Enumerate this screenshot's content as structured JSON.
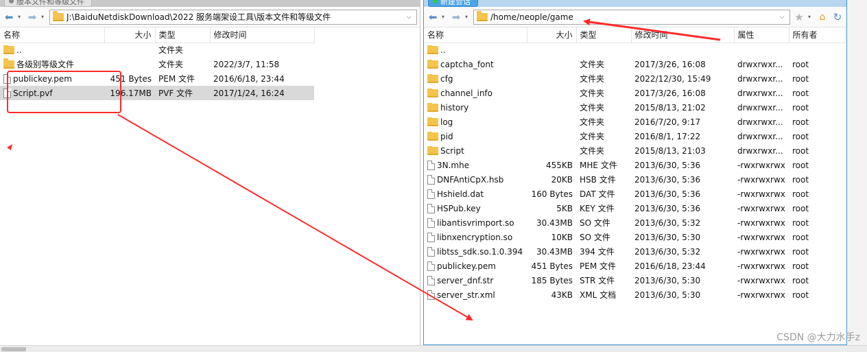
{
  "colors": {
    "annotation_red": "#ff2a2a",
    "accent_blue": "#3f95d6"
  },
  "left": {
    "tab_label": "版本文件和等级文件",
    "path": "J:\\BaiduNetdiskDownload\\2022 服务端架设工具\\版本文件和等级文件",
    "columns": {
      "name": "名称",
      "size": "大小",
      "type": "类型",
      "modified": "修改时间"
    },
    "rows": [
      {
        "icon": "folder-icon",
        "name": "..",
        "size": "",
        "type": "文件夹",
        "modified": ""
      },
      {
        "icon": "folder-icon",
        "name": "各级别等级文件",
        "size": "",
        "type": "文件夹",
        "modified": "2022/3/7, 11:58"
      },
      {
        "icon": "file-icon",
        "name": "publickey.pem",
        "size": "451 Bytes",
        "type": "PEM 文件",
        "modified": "2016/6/18, 23:44"
      },
      {
        "icon": "file-icon",
        "name": "Script.pvf",
        "size": "196.17MB",
        "type": "PVF 文件",
        "modified": "2017/1/24, 16:24"
      }
    ]
  },
  "right": {
    "tab_label": "新建会话",
    "path": "/home/neople/game",
    "columns": {
      "name": "名称",
      "size": "大小",
      "type": "类型",
      "modified": "修改时间",
      "attr": "属性",
      "owner": "所有者"
    },
    "rows": [
      {
        "icon": "folder-icon",
        "name": "..",
        "size": "",
        "type": "",
        "modified": "",
        "attr": "",
        "owner": ""
      },
      {
        "icon": "folder-icon",
        "name": "captcha_font",
        "size": "",
        "type": "文件夹",
        "modified": "2017/3/26, 16:08",
        "attr": "drwxrwxr...",
        "owner": "root"
      },
      {
        "icon": "folder-icon",
        "name": "cfg",
        "size": "",
        "type": "文件夹",
        "modified": "2022/12/30, 15:49",
        "attr": "drwxrwxr...",
        "owner": "root"
      },
      {
        "icon": "folder-icon",
        "name": "channel_info",
        "size": "",
        "type": "文件夹",
        "modified": "2017/3/26, 16:08",
        "attr": "drwxrwxr...",
        "owner": "root"
      },
      {
        "icon": "folder-icon",
        "name": "history",
        "size": "",
        "type": "文件夹",
        "modified": "2015/8/13, 21:02",
        "attr": "drwxrwxr...",
        "owner": "root"
      },
      {
        "icon": "folder-icon",
        "name": "log",
        "size": "",
        "type": "文件夹",
        "modified": "2016/7/20, 9:17",
        "attr": "drwxrwxr...",
        "owner": "root"
      },
      {
        "icon": "folder-icon",
        "name": "pid",
        "size": "",
        "type": "文件夹",
        "modified": "2016/8/1, 17:22",
        "attr": "drwxrwxr...",
        "owner": "root"
      },
      {
        "icon": "folder-icon",
        "name": "Script",
        "size": "",
        "type": "文件夹",
        "modified": "2015/8/13, 21:03",
        "attr": "drwxrwxr...",
        "owner": "root"
      },
      {
        "icon": "file-icon",
        "name": "3N.mhe",
        "size": "455KB",
        "type": "MHE 文件",
        "modified": "2013/6/30, 5:36",
        "attr": "-rwxrwxrwx",
        "owner": "root"
      },
      {
        "icon": "file-icon",
        "name": "DNFAntiCpX.hsb",
        "size": "20KB",
        "type": "HSB 文件",
        "modified": "2013/6/30, 5:36",
        "attr": "-rwxrwxrwx",
        "owner": "root"
      },
      {
        "icon": "file-icon",
        "name": "Hshield.dat",
        "size": "160 Bytes",
        "type": "DAT 文件",
        "modified": "2013/6/30, 5:36",
        "attr": "-rwxrwxrwx",
        "owner": "root"
      },
      {
        "icon": "file-icon",
        "name": "HSPub.key",
        "size": "5KB",
        "type": "KEY 文件",
        "modified": "2013/6/30, 5:36",
        "attr": "-rwxrwxrwx",
        "owner": "root"
      },
      {
        "icon": "file-icon",
        "name": "libantisvrimport.so",
        "size": "30.43MB",
        "type": "SO 文件",
        "modified": "2013/6/30, 5:32",
        "attr": "-rwxrwxrwx",
        "owner": "root"
      },
      {
        "icon": "file-icon",
        "name": "libnxencryption.so",
        "size": "10KB",
        "type": "SO 文件",
        "modified": "2013/6/30, 5:30",
        "attr": "-rwxrwxrwx",
        "owner": "root"
      },
      {
        "icon": "file-icon",
        "name": "libtss_sdk.so.1.0.394",
        "size": "30.43MB",
        "type": "394 文件",
        "modified": "2013/6/30, 5:32",
        "attr": "-rwxrwxrwx",
        "owner": "root"
      },
      {
        "icon": "file-icon",
        "name": "publickey.pem",
        "size": "451 Bytes",
        "type": "PEM 文件",
        "modified": "2016/6/18, 23:44",
        "attr": "-rwxrwxrwx",
        "owner": "root"
      },
      {
        "icon": "file-icon",
        "name": "server_dnf.str",
        "size": "185 Bytes",
        "type": "STR 文件",
        "modified": "2013/6/30, 5:30",
        "attr": "-rwxrwxrwx",
        "owner": "root"
      },
      {
        "icon": "file-icon",
        "name": "server_str.xml",
        "size": "43KB",
        "type": "XML 文档",
        "modified": "2013/6/30, 5:30",
        "attr": "-rwxrwxrwx",
        "owner": "root"
      }
    ]
  },
  "watermark": "CSDN @大力水手z"
}
